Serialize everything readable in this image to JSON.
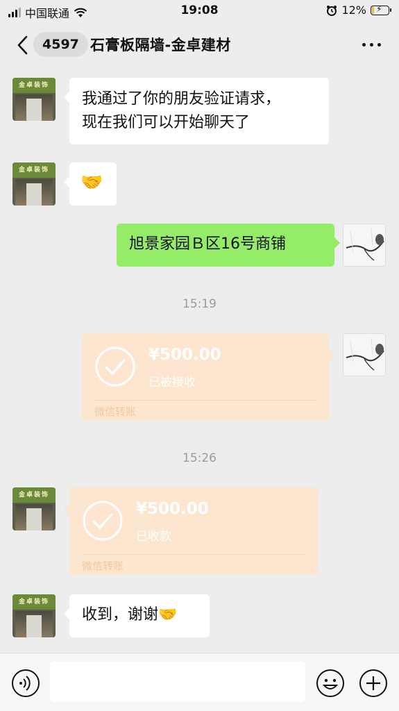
{
  "status_bar": {
    "carrier": "中国联通",
    "time": "19:08",
    "battery": "12%"
  },
  "nav": {
    "unread_count": "4597",
    "title": "石膏板隔墙-金卓建材"
  },
  "contact_avatar_sign": "金卓装饰",
  "messages": [
    {
      "from": "contact",
      "text_line1": "我通过了你的朋友验证请求，",
      "text_line2": "现在我们可以开始聊天了"
    },
    {
      "from": "contact",
      "text": "🤝"
    },
    {
      "from": "me",
      "text": "旭景家园Ｂ区16号商铺"
    },
    {
      "type": "timestamp",
      "text": "15:19"
    },
    {
      "from": "me",
      "type": "transfer",
      "amount": "¥500.00",
      "status": "已被接收",
      "footer": "微信转账"
    },
    {
      "type": "timestamp",
      "text": "15:26"
    },
    {
      "from": "contact",
      "type": "transfer",
      "amount": "¥500.00",
      "status": "已收款",
      "footer": "微信转账"
    },
    {
      "from": "contact",
      "text": "收到，谢谢🤝"
    }
  ],
  "colors": {
    "background": "#ededed",
    "my_bubble": "#95ec69",
    "their_bubble": "#ffffff",
    "transfer_received": "#fde6cf"
  }
}
